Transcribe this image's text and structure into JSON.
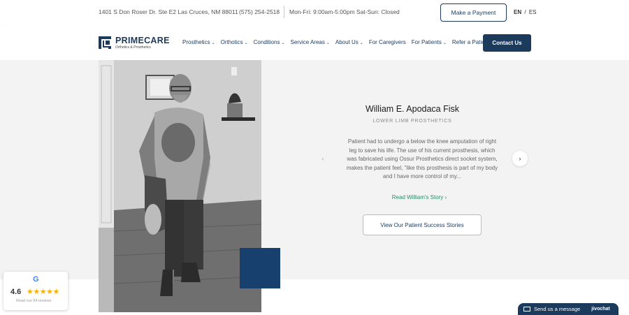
{
  "topbar": {
    "address": "1401 S Don Roser Dr. Ste E2 Las Cruces, NM 88011",
    "phone": "(575) 254-2518",
    "hours": "Mon-Fri: 9:00am-5:00pm  Sat-Sun: Closed",
    "payment_label": "Make a Payment",
    "lang_en": "EN",
    "lang_sep": "/",
    "lang_es": "ES"
  },
  "nav": {
    "logo_name": "PRIMECARE",
    "logo_sub": "Orthotics & Prosthetics",
    "items": [
      {
        "label": "Prosthetics",
        "dropdown": true
      },
      {
        "label": "Orthotics",
        "dropdown": true
      },
      {
        "label": "Conditions",
        "dropdown": true
      },
      {
        "label": "Service Areas",
        "dropdown": true
      },
      {
        "label": "About Us",
        "dropdown": true
      },
      {
        "label": "For Caregivers",
        "dropdown": false
      },
      {
        "label": "For Patients",
        "dropdown": true
      },
      {
        "label": "Refer a Patient",
        "dropdown": false
      }
    ],
    "contact_label": "Contact Us"
  },
  "testimonial": {
    "name": "William E. Apodaca Fisk",
    "category": "LOWER LIMB PROSTHETICS",
    "text": "Patient had to undergo a below the knee amputation of right leg to save his life. The use of his current prosthesis, which was fabricated using Ossur Prosthetics direct socket system, makes the patient feel, \"like this prosthesis is part of my body and I have more control of my...",
    "link_label": "Read William's Story",
    "link_arrow": "›",
    "prev_icon": "‹",
    "next_icon": "›",
    "stories_button": "View Our Patient Success Stories"
  },
  "google_badge": {
    "icon": "G",
    "rating": "4.6",
    "stars": "★★★★★",
    "reviews": "Read our 94 reviews"
  },
  "chat": {
    "label": "Send us a message",
    "brand": "jivochat"
  },
  "colors": {
    "brand_navy": "#1b3a5c",
    "accent_blue": "#17406f",
    "link_green": "#2a8a6e",
    "star_gold": "#f4b400"
  }
}
